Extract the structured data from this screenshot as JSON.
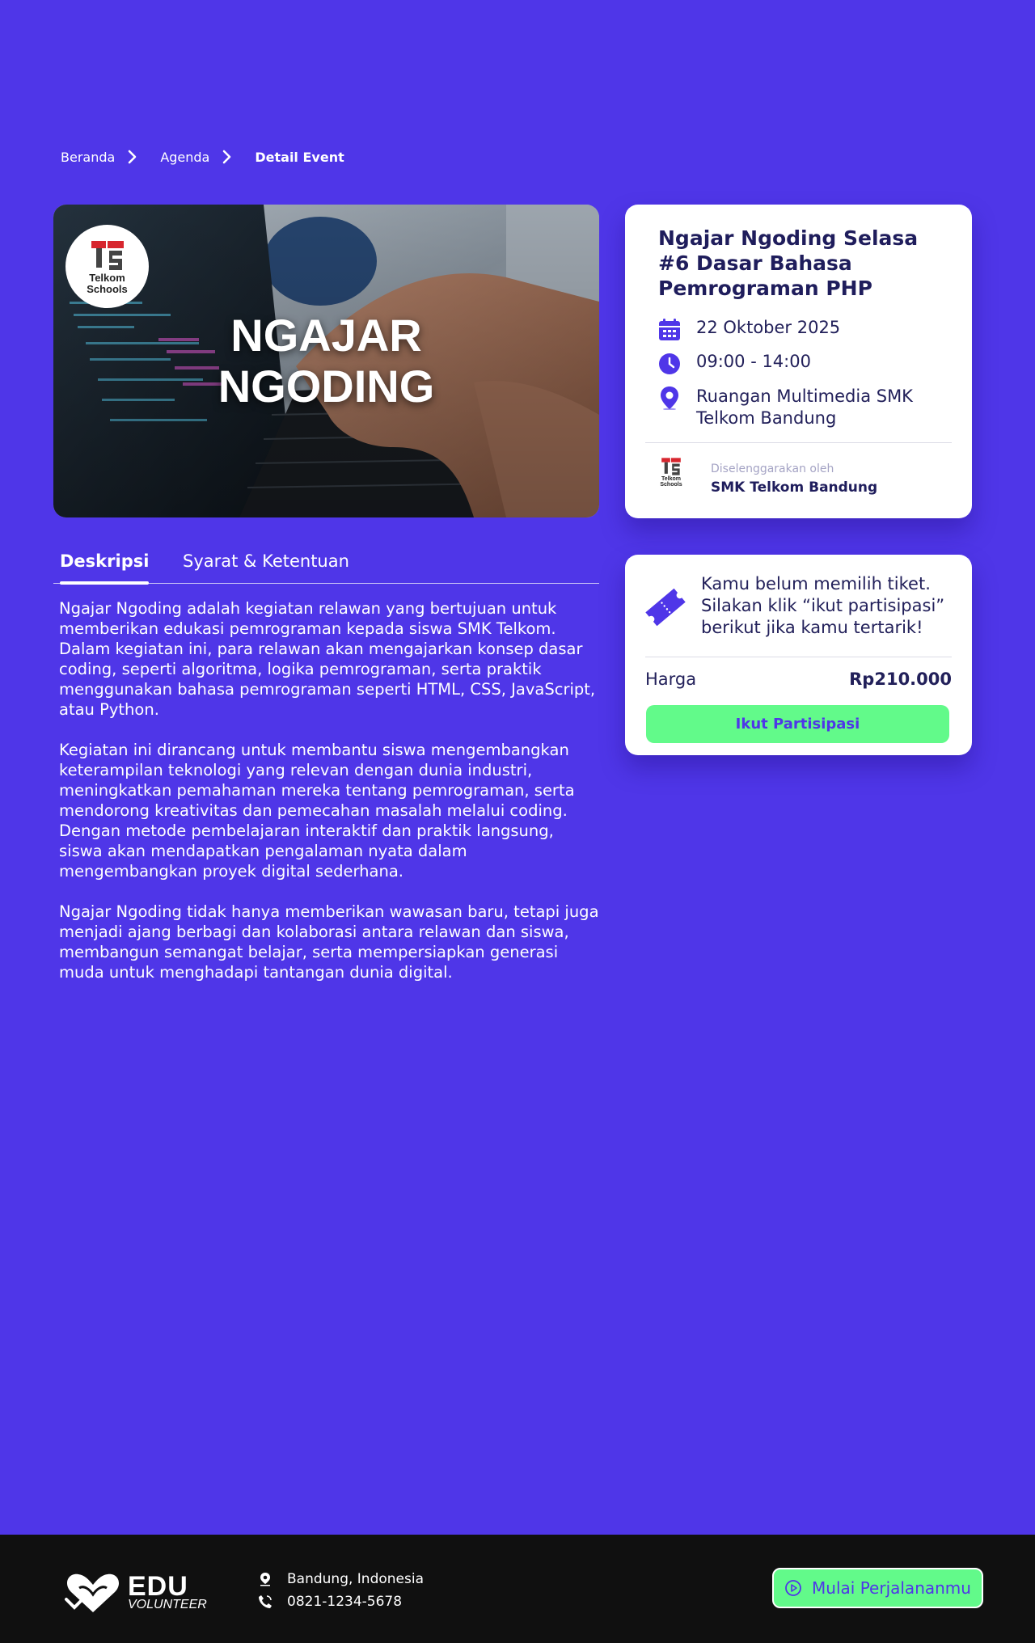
{
  "breadcrumb": {
    "items": [
      "Beranda",
      "Agenda",
      "Detail Event"
    ]
  },
  "hero": {
    "logo_text_1": "Telkom",
    "logo_text_2": "Schools",
    "title_line_1": "NGAJAR",
    "title_line_2": "NGODING"
  },
  "event": {
    "title": "Ngajar Ngoding Selasa #6 Dasar Bahasa Pemrograman PHP",
    "date": "22 Oktober 2025",
    "time": "09:00 - 14:00",
    "location": "Ruangan Multimedia SMK Telkom Bandung",
    "organizer_label": "Diselenggarakan oleh",
    "organizer_name": "SMK Telkom Bandung",
    "organizer_logo_1": "Telkom",
    "organizer_logo_2": "Schools"
  },
  "ticket": {
    "message": "Kamu belum memilih tiket. Silakan klik “ikut partisipasi” berikut jika kamu tertarik!",
    "price_label": "Harga",
    "price_value": "Rp210.000",
    "button_label": "Ikut Partisipasi"
  },
  "tabs": [
    {
      "label": "Deskripsi",
      "active": true
    },
    {
      "label": "Syarat & Ketentuan",
      "active": false
    }
  ],
  "description": [
    "Ngajar Ngoding adalah kegiatan relawan yang bertujuan untuk memberikan edukasi pemrograman kepada siswa SMK Telkom. Dalam kegiatan ini, para relawan akan mengajarkan konsep dasar coding, seperti algoritma, logika pemrograman, serta praktik menggunakan bahasa pemrograman seperti HTML, CSS, JavaScript, atau Python.",
    "Kegiatan ini dirancang untuk membantu siswa mengembangkan keterampilan teknologi yang relevan dengan dunia industri, meningkatkan pemahaman mereka tentang pemrograman, serta mendorong kreativitas dan pemecahan masalah melalui coding. Dengan metode pembelajaran interaktif dan praktik langsung, siswa akan mendapatkan pengalaman nyata dalam mengembangkan proyek digital sederhana.",
    "Ngajar Ngoding tidak hanya memberikan wawasan baru, tetapi juga menjadi ajang berbagi dan kolaborasi antara relawan dan siswa, membangun semangat belajar, serta mempersiapkan generasi muda untuk menghadapi tantangan dunia digital."
  ],
  "footer": {
    "brand_main": "EDU",
    "brand_sub": "VOLUNTEER",
    "location": "Bandung, Indonesia",
    "phone": "0821-1234-5678",
    "cta_label": "Mulai Perjalananmu"
  },
  "colors": {
    "background": "#4f36e8",
    "accent_green": "#62fa8a",
    "card_text": "#22205a",
    "footer_bg": "#101010"
  },
  "icons": [
    "chevron-right-icon",
    "calendar-icon",
    "clock-icon",
    "location-pin-icon",
    "ticket-icon",
    "heart-logo-icon",
    "phone-icon",
    "play-circle-icon"
  ]
}
